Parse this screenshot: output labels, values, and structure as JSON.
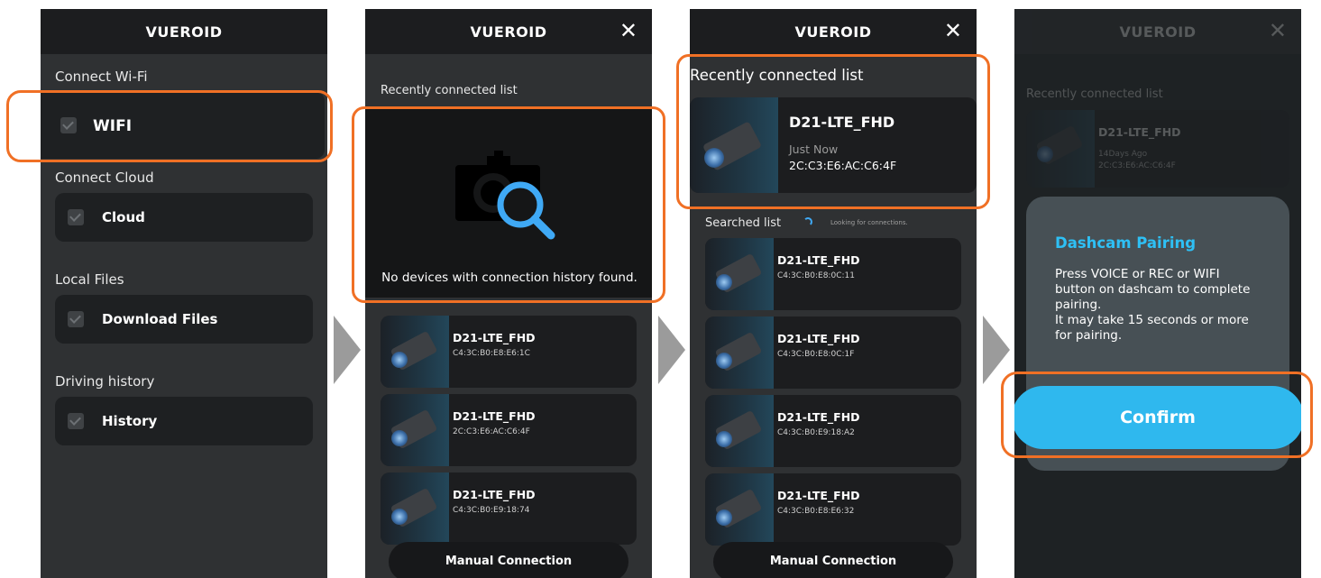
{
  "panel1": {
    "title": "VUEROID",
    "sections": [
      {
        "label": "Connect Wi-Fi",
        "item": "WIFI"
      },
      {
        "label": "Connect Cloud",
        "item": "Cloud"
      },
      {
        "label": "Local Files",
        "item": "Download Files"
      },
      {
        "label": "Driving history",
        "item": "History"
      }
    ]
  },
  "panel2": {
    "title": "VUEROID",
    "close": "✕",
    "recent_label": "Recently connected list",
    "empty_message": "No devices with connection history found.",
    "devices": [
      {
        "name": "D21-LTE_FHD",
        "mac": "C4:3C:B0:E8:E6:1C"
      },
      {
        "name": "D21-LTE_FHD",
        "mac": "2C:C3:E6:AC:C6:4F"
      },
      {
        "name": "D21-LTE_FHD",
        "mac": "C4:3C:B0:E9:18:74"
      }
    ],
    "manual_button": "Manual Connection"
  },
  "panel3": {
    "title": "VUEROID",
    "close": "✕",
    "recent_label": "Recently connected list",
    "recent_device": {
      "name": "D21-LTE_FHD",
      "time": "Just Now",
      "mac": "2C:C3:E6:AC:C6:4F"
    },
    "searched_label": "Searched list",
    "looking": "Looking for connections.",
    "devices": [
      {
        "name": "D21-LTE_FHD",
        "mac": "C4:3C:B0:E8:0C:11"
      },
      {
        "name": "D21-LTE_FHD",
        "mac": "C4:3C:B0:E8:0C:1F"
      },
      {
        "name": "D21-LTE_FHD",
        "mac": "C4:3C:B0:E9:18:A2"
      },
      {
        "name": "D21-LTE_FHD",
        "mac": "C4:3C:B0:E8:E6:32"
      }
    ],
    "manual_button": "Manual Connection"
  },
  "panel4": {
    "title": "VUEROID",
    "close": "✕",
    "recent_label": "Recently connected list",
    "recent_device": {
      "name": "D21-LTE_FHD",
      "time": "14Days Ago",
      "mac": "2C:C3:E6:AC:C6:4F"
    },
    "dialog": {
      "title": "Dashcam Pairing",
      "message": "Press VOICE or REC or WIFI button on dashcam to complete pairing.\nIt may take 15 seconds or more for pairing.",
      "confirm": "Confirm"
    }
  },
  "colors": {
    "highlight": "#f07025",
    "accent": "#2fb8ee",
    "panel_bg": "#2f3133",
    "header_bg": "#1c1d1f"
  }
}
